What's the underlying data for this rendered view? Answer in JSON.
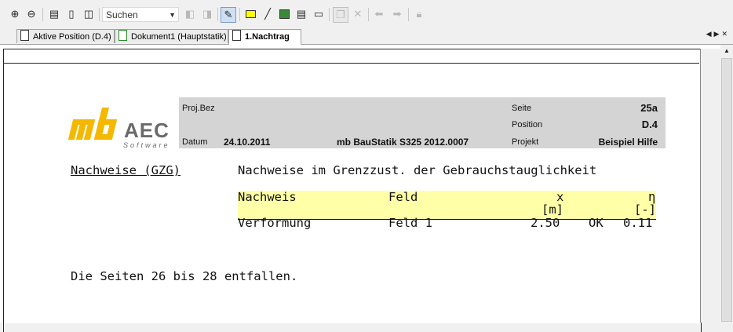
{
  "toolbar": {
    "search_label": "Suchen"
  },
  "tabs": [
    {
      "label": "Aktive Position (D.4)"
    },
    {
      "label": "Dokument1 (Hauptstatik)"
    },
    {
      "label": "1.Nachtrag"
    }
  ],
  "header": {
    "proj_bez_label": "Proj.Bez",
    "datum_label": "Datum",
    "datum_value": "24.10.2011",
    "program": "mb BauStatik S325  2012.0007",
    "seite_label": "Seite",
    "seite_value": "25a",
    "position_label": "Position",
    "position_value": "D.4",
    "projekt_label": "Projekt",
    "projekt_value": "Beispiel Hilfe"
  },
  "logo": {
    "brand_mb": "mb",
    "brand_aec": "AEC",
    "tagline": "Software"
  },
  "section": {
    "heading": "Nachweise (GZG)",
    "description": "Nachweise im Grenzzust. der Gebrauchstauglichkeit"
  },
  "table": {
    "headers": {
      "nachweis": "Nachweis",
      "feld": "Feld",
      "x": "x",
      "x_unit": "[m]",
      "eta": "η",
      "eta_unit": "[-]"
    },
    "rows": [
      {
        "nachweis": "Verformung",
        "feld": "Feld 1",
        "x": "2.50",
        "status": "OK",
        "eta": "0.11"
      }
    ]
  },
  "note": "Die Seiten 26 bis 28 entfallen.",
  "colors": {
    "logo_yellow": "#f5b800",
    "logo_grey": "#6a6a6a",
    "highlight": "#ffffa8"
  }
}
